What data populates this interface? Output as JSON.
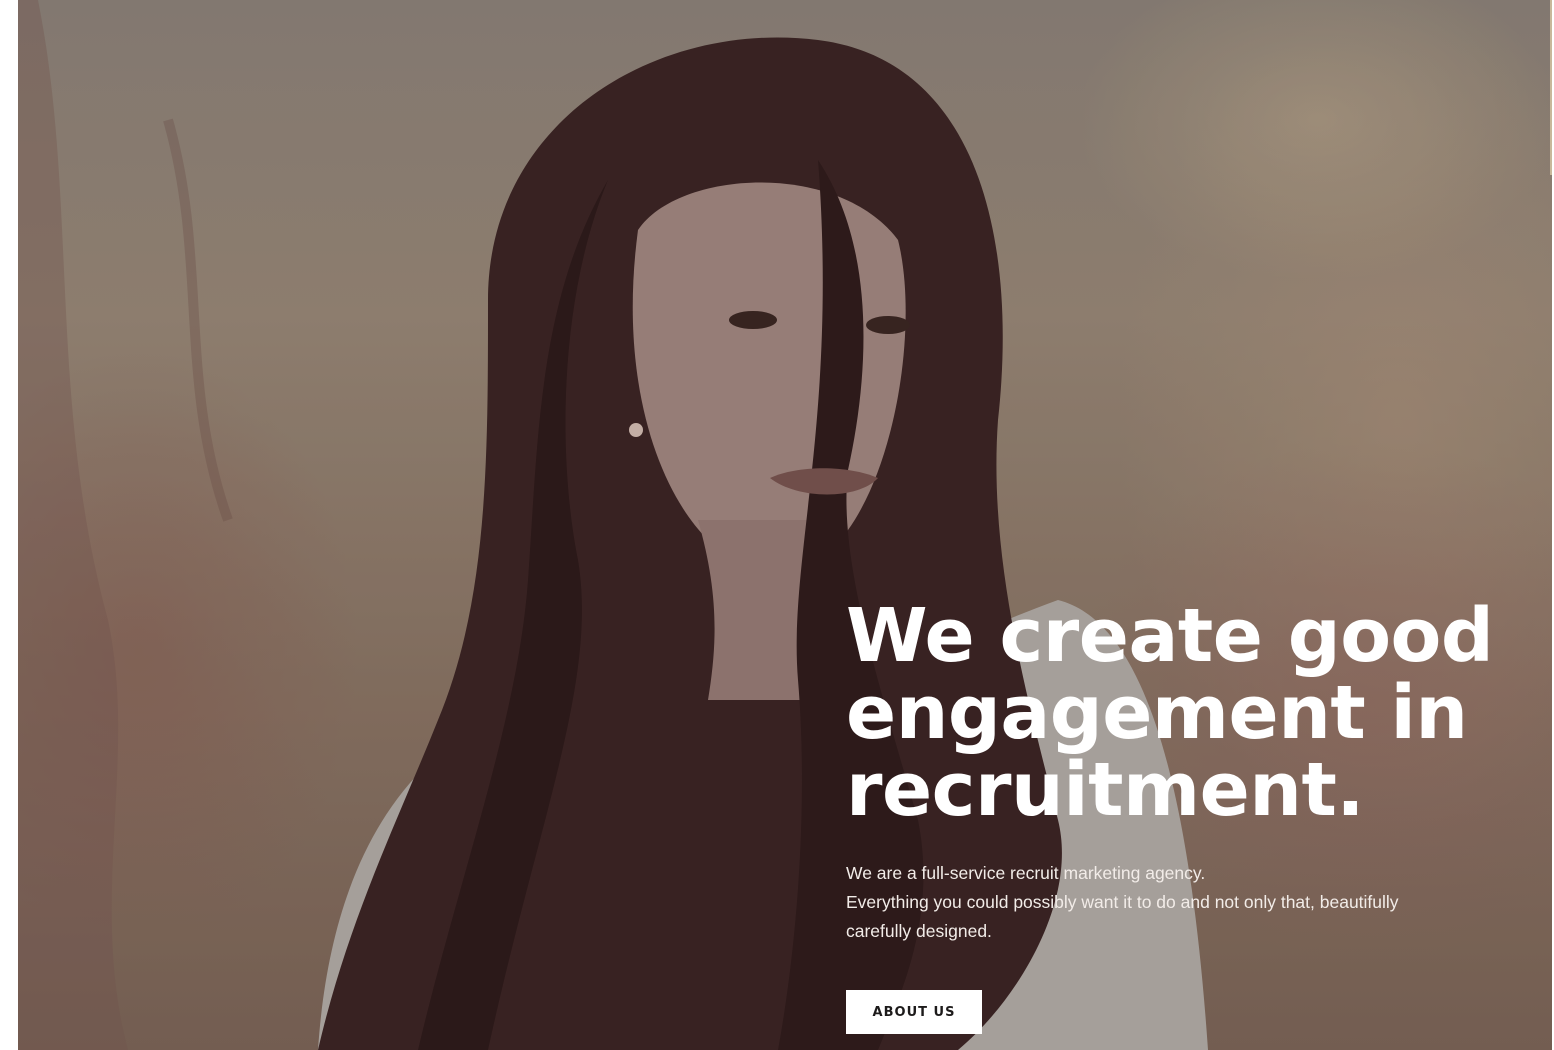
{
  "hero": {
    "headline": [
      "We create good",
      "engagement in",
      "recruitment."
    ],
    "intro": [
      "We are a full-service recruit marketing agency.",
      "Everything you could possibly want it to do and not only that, beautifully",
      "carefully designed."
    ],
    "cta_label": "ABOUT US"
  },
  "colors": {
    "text": "#ffffff",
    "button_bg": "#ffffff",
    "button_text": "#1d1b1b"
  }
}
